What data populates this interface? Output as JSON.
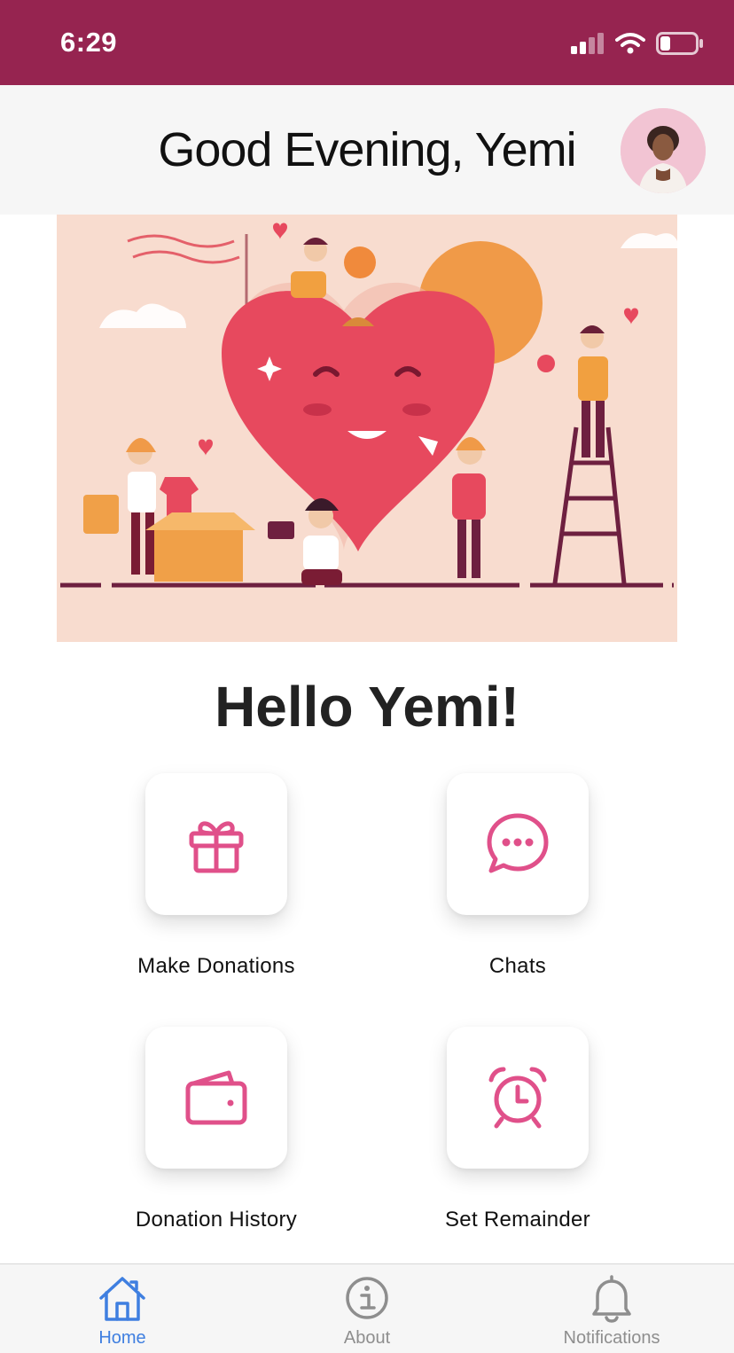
{
  "status_bar": {
    "time": "6:29",
    "icons": [
      "signal-icon",
      "wifi-icon",
      "battery-icon"
    ],
    "background": "#962450"
  },
  "header": {
    "greeting": "Good Evening, Yemi",
    "avatar": "user-avatar"
  },
  "hero": {
    "illustration": "charity-heart-illustration"
  },
  "main": {
    "headline": "Hello Yemi!",
    "accent_color": "#e0508a",
    "actions": [
      {
        "label": "Make Donations",
        "icon": "gift-icon"
      },
      {
        "label": "Chats",
        "icon": "chat-bubble-icon"
      },
      {
        "label": "Donation History",
        "icon": "wallet-icon"
      },
      {
        "label": "Set Remainder",
        "icon": "alarm-clock-icon"
      }
    ]
  },
  "tabbar": {
    "active_color": "#3f7fe0",
    "inactive_color": "#8e8e8e",
    "tabs": [
      {
        "label": "Home",
        "icon": "home-icon",
        "active": true
      },
      {
        "label": "About",
        "icon": "info-icon",
        "active": false
      },
      {
        "label": "Notifications",
        "icon": "bell-icon",
        "active": false
      }
    ]
  }
}
